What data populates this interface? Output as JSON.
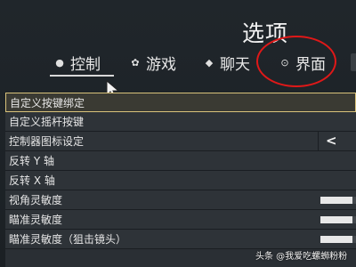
{
  "header": {
    "title": "选项"
  },
  "tabs": [
    {
      "label": "控制",
      "icon": "controller-icon",
      "glyph": "●",
      "active": true
    },
    {
      "label": "游戏",
      "icon": "gear-icon",
      "glyph": "✿",
      "active": false
    },
    {
      "label": "聊天",
      "icon": "chat-bubble-icon",
      "glyph": "◆",
      "active": false
    },
    {
      "label": "界面",
      "icon": "interface-icon",
      "glyph": "⊙",
      "active": false
    }
  ],
  "settings": [
    {
      "label": "自定义按键绑定",
      "control": "none",
      "selected": true
    },
    {
      "label": "自定义摇杆按键",
      "control": "none",
      "selected": false
    },
    {
      "label": "控制器图标设定",
      "control": "arrow",
      "arrow": "<",
      "selected": false
    },
    {
      "label": "反转 Y 轴",
      "control": "none",
      "selected": false
    },
    {
      "label": "反转 X 轴",
      "control": "none",
      "selected": false
    },
    {
      "label": "视角灵敏度",
      "control": "slider",
      "value": 0.9,
      "selected": false
    },
    {
      "label": "瞄准灵敏度",
      "control": "slider",
      "value": 0.9,
      "selected": false
    },
    {
      "label": "瞄准灵敏度（狙击镜头）",
      "control": "slider",
      "value": 0.9,
      "selected": false
    }
  ],
  "watermark": {
    "text": "头条 @我爱吃螺蛳粉粉"
  },
  "colors": {
    "background": "#1c2126",
    "row": "#2e3338",
    "selected_border": "#d9c27a",
    "annotation": "#e01818",
    "text": "#e6e6e6"
  }
}
